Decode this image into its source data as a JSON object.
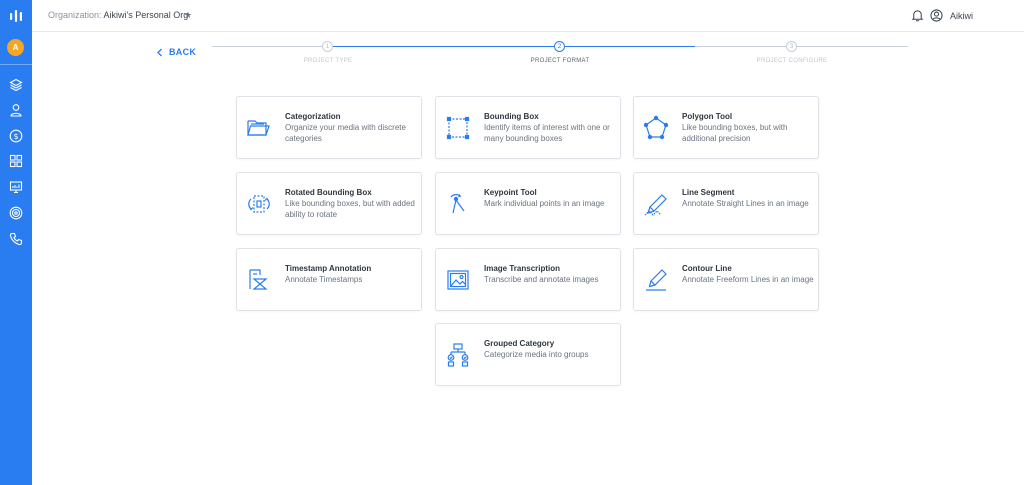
{
  "header": {
    "org_label": "Organization:",
    "org_name": "Aikiwi's Personal Org",
    "user_name": "Aikiwi"
  },
  "sidebar": {
    "avatar_letter": "A",
    "items": [
      "layers-icon",
      "user-icon",
      "billing-icon",
      "grid-icon",
      "monitor-icon",
      "target-icon",
      "phone-icon"
    ]
  },
  "stepper": {
    "back_label": "BACK",
    "steps": [
      {
        "number": "1",
        "label": "PROJECT TYPE",
        "active": false
      },
      {
        "number": "2",
        "label": "PROJECT FORMAT",
        "active": true
      },
      {
        "number": "3",
        "label": "PROJECT CONFIGURE",
        "active": false
      }
    ]
  },
  "cards": [
    {
      "title": "Categorization",
      "desc": "Organize your media with discrete categories",
      "icon": "folder-icon"
    },
    {
      "title": "Bounding Box",
      "desc": "Identify items of interest with one or many bounding boxes",
      "icon": "bounding-box-icon"
    },
    {
      "title": "Polygon Tool",
      "desc": "Like bounding boxes, but with additional precision",
      "icon": "polygon-icon"
    },
    {
      "title": "Rotated Bounding Box",
      "desc": "Like bounding boxes, but with added ability to rotate",
      "icon": "rotated-box-icon"
    },
    {
      "title": "Keypoint Tool",
      "desc": "Mark individual points in an image",
      "icon": "keypoint-icon"
    },
    {
      "title": "Line Segment",
      "desc": "Annotate Straight Lines in an image",
      "icon": "line-segment-icon"
    },
    {
      "title": "Timestamp Annotation",
      "desc": "Annotate Timestamps",
      "icon": "timestamp-icon"
    },
    {
      "title": "Image Transcription",
      "desc": "Transcribe and annotate images",
      "icon": "image-icon"
    },
    {
      "title": "Contour Line",
      "desc": "Annotate Freeform Lines in an image",
      "icon": "contour-line-icon"
    },
    {
      "title": "Grouped Category",
      "desc": "Categorize media into groups",
      "icon": "grouped-category-icon"
    }
  ],
  "colors": {
    "primary": "#2a7df0",
    "avatar": "#f5a623"
  }
}
